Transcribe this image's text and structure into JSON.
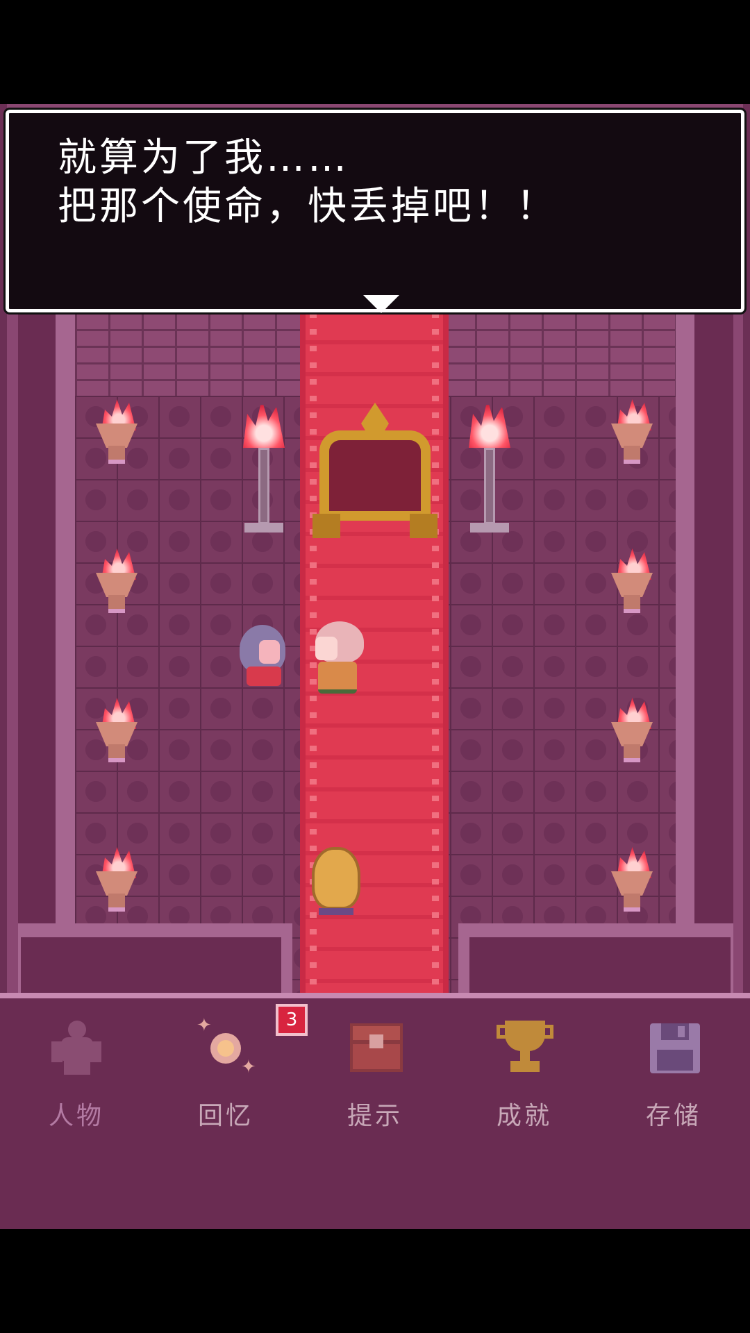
{
  "dialogue": {
    "line1": "就算为了我……",
    "line2": "把那个使命，快丢掉吧！！"
  },
  "menu": {
    "items": [
      {
        "label": "人物",
        "icon": "person-icon",
        "color": "#b37aa3"
      },
      {
        "label": "回忆",
        "icon": "memory-icon",
        "color": "#e4a8a0",
        "badge": "3"
      },
      {
        "label": "提示",
        "icon": "treasure-chest-icon",
        "color": "#c8a8b8"
      },
      {
        "label": "成就",
        "icon": "trophy-icon",
        "color": "#c8a8b8"
      },
      {
        "label": "存储",
        "icon": "save-disk-icon",
        "color": "#c8a8b8"
      }
    ]
  },
  "colors": {
    "carpet": "#e03a52",
    "menu_bg": "#6a2c52",
    "badge": "#d8243f"
  }
}
